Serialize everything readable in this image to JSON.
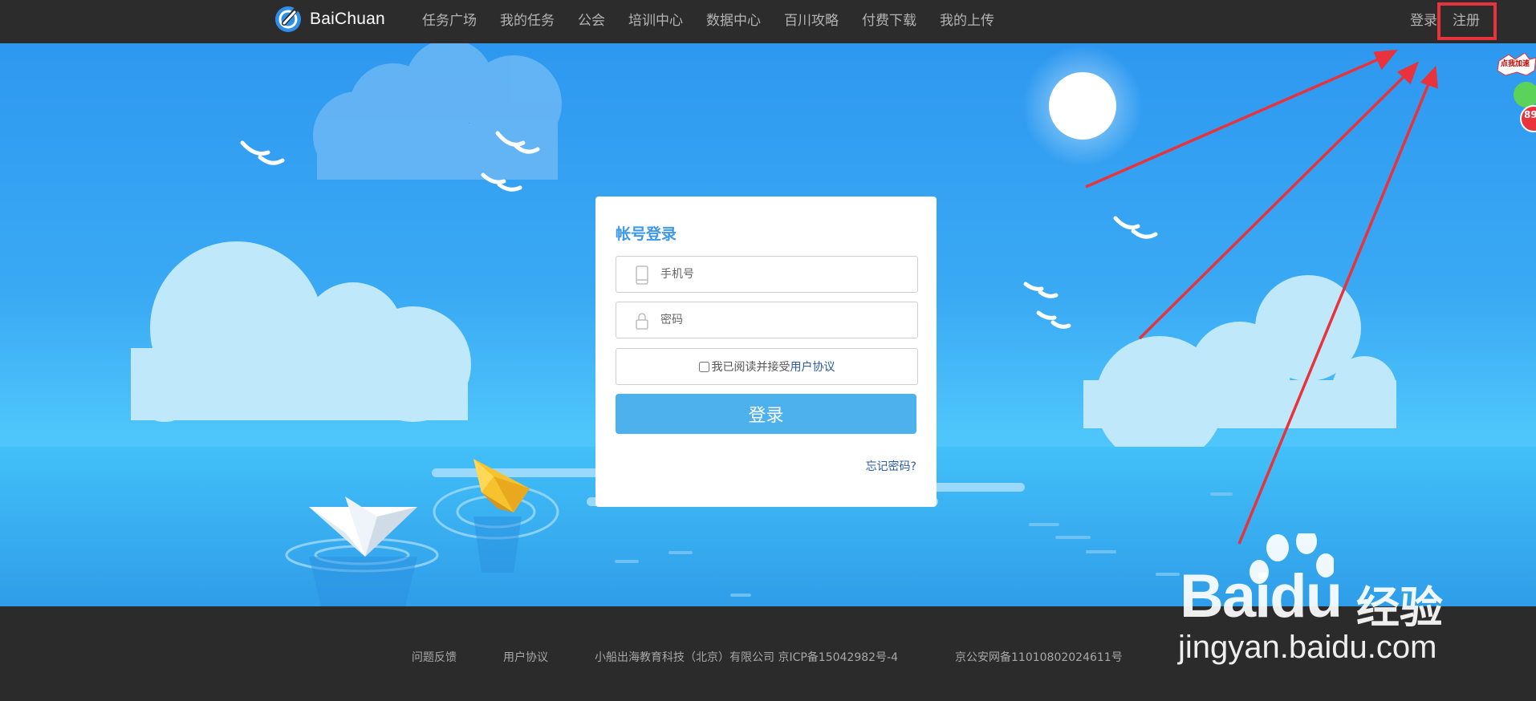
{
  "header": {
    "logo_text": "BaiChuan",
    "nav": [
      "任务广场",
      "我的任务",
      "公会",
      "培训中心",
      "数据中心",
      "百川攻略",
      "付费下载",
      "我的上传"
    ],
    "login_link": "登录",
    "register_link": "注册"
  },
  "login_card": {
    "title": "帐号登录",
    "phone_placeholder": "手机号",
    "password_placeholder": "密码",
    "agree_text": "我已阅读并接受",
    "agree_link": "用户协议",
    "login_button": "登录",
    "forgot_link": "忘记密码?"
  },
  "footer": {
    "feedback": "问题反馈",
    "agreement": "用户协议",
    "company": "小船出海教育科技（北京）有限公司 京ICP备15042982号-4",
    "police": "京公安网备11010802024611号"
  },
  "floating_widget": {
    "tag": "点我加速",
    "number": "89"
  },
  "watermark": {
    "brand": "Baidu",
    "cn": "经验",
    "url": "jingyan.baidu.com"
  },
  "colors": {
    "nav_bg": "#2c2c2c",
    "sky_top": "#2e98f0",
    "sea": "#3fb6f5",
    "accent_blue": "#4db1ee",
    "title_blue": "#3d98e8",
    "highlight_red": "#e8323c"
  }
}
